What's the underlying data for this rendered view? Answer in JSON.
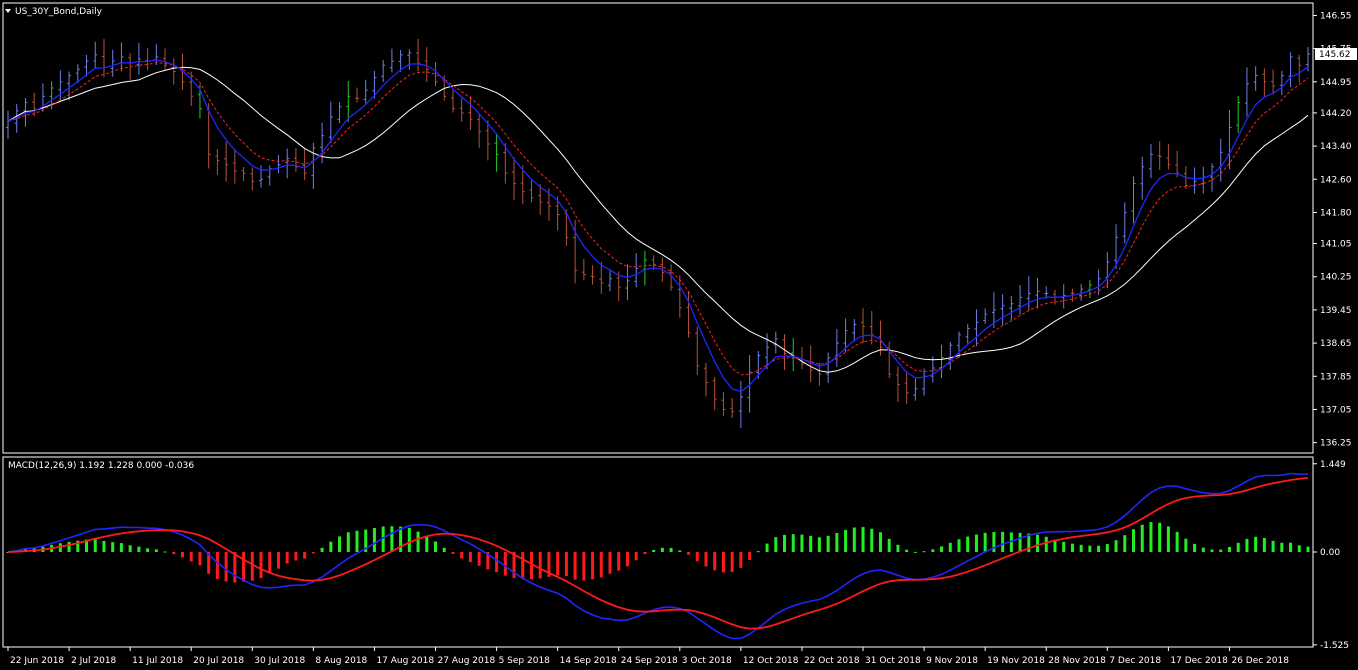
{
  "window": {
    "main_title": "US_30Y_Bond,Daily",
    "indicator_title": "MACD(12,26,9) 1.192 1.228 0.000 -0.036",
    "current_price_label": "145.62"
  },
  "colors": {
    "background": "#000000",
    "axis": "#ffffff",
    "bull_bar": "#6f7fe8",
    "bear_bar": "#b5533a",
    "green_bar": "#22cc22",
    "ma_fast": "#1f26ff",
    "ma_signal": "#ff2020",
    "ma_slow": "#ffffff",
    "hist_pos": "#22ee22",
    "hist_neg": "#ff1a1a",
    "macd_line": "#1f26ff",
    "signal_line": "#ff1a1a"
  },
  "chart_data": [
    {
      "type": "ohlc",
      "name": "US_30Y_Bond,Daily",
      "ylim": [
        136.0,
        146.85
      ],
      "y_ticks": [
        "146.55",
        "145.75",
        "144.95",
        "144.20",
        "143.40",
        "142.60",
        "141.80",
        "141.05",
        "140.25",
        "139.45",
        "138.65",
        "137.85",
        "137.05",
        "136.25"
      ],
      "x_tick_labels": [
        "22 Jun 2018",
        "2 Jul 2018",
        "11 Jul 2018",
        "20 Jul 2018",
        "30 Jul 2018",
        "8 Aug 2018",
        "17 Aug 2018",
        "27 Aug 2018",
        "5 Sep 2018",
        "14 Sep 2018",
        "24 Sep 2018",
        "3 Oct 2018",
        "12 Oct 2018",
        "22 Oct 2018",
        "31 Oct 2018",
        "9 Nov 2018",
        "19 Nov 2018",
        "28 Nov 2018",
        "7 Dec 2018",
        "17 Dec 2018",
        "26 Dec 2018"
      ],
      "x_tick_index": [
        0,
        7,
        14,
        21,
        28,
        35,
        42,
        49,
        56,
        63,
        70,
        77,
        84,
        91,
        98,
        105,
        112,
        119,
        126,
        133,
        140
      ],
      "current_price": 145.62,
      "close": [
        144.0,
        144.25,
        144.45,
        144.3,
        144.6,
        144.8,
        144.95,
        145.1,
        145.25,
        145.45,
        145.6,
        145.3,
        145.45,
        145.55,
        145.4,
        145.5,
        145.45,
        145.55,
        145.35,
        145.2,
        144.95,
        144.6,
        144.3,
        143.2,
        143.05,
        142.95,
        142.8,
        142.75,
        142.55,
        142.6,
        142.85,
        142.95,
        143.1,
        142.9,
        142.75,
        143.35,
        143.65,
        144.1,
        144.35,
        144.6,
        144.55,
        144.75,
        145.05,
        145.35,
        145.45,
        145.6,
        145.65,
        145.4,
        145.25,
        144.95,
        144.6,
        144.3,
        144.2,
        144.05,
        143.75,
        143.45,
        143.2,
        142.75,
        142.5,
        142.3,
        142.15,
        142.05,
        141.95,
        141.75,
        141.2,
        140.4,
        140.3,
        140.25,
        140.1,
        140.2,
        140.0,
        140.15,
        140.45,
        140.65,
        140.55,
        140.35,
        140.0,
        139.5,
        138.9,
        138.1,
        137.7,
        137.3,
        137.05,
        137.0,
        137.35,
        137.95,
        138.35,
        138.55,
        138.75,
        138.4,
        138.3,
        138.15,
        138.0,
        137.9,
        138.3,
        138.65,
        138.95,
        139.1,
        139.05,
        138.85,
        138.55,
        137.9,
        137.65,
        137.45,
        137.55,
        137.85,
        138.05,
        138.3,
        138.6,
        138.85,
        139.0,
        139.15,
        139.35,
        139.45,
        139.55,
        139.6,
        139.75,
        139.85,
        139.9,
        139.85,
        139.75,
        139.8,
        139.85,
        139.95,
        140.05,
        140.2,
        140.6,
        141.2,
        141.8,
        142.5,
        142.9,
        143.2,
        143.15,
        142.95,
        142.75,
        142.45,
        142.55,
        142.65,
        142.9,
        143.25,
        143.85,
        144.45,
        144.9,
        145.1,
        144.95,
        144.85,
        145.1,
        145.55,
        145.35,
        145.62
      ]
    },
    {
      "type": "macd",
      "name": "MACD(12,26,9)",
      "params": [
        12,
        26,
        9
      ],
      "values_shown": [
        1.192,
        1.228,
        0.0,
        -0.036
      ],
      "ylim": [
        -1.56,
        1.56
      ],
      "y_ticks": [
        "1.449",
        "0.00",
        "-1.525"
      ],
      "y_tick_values": [
        1.449,
        0.0,
        -1.525
      ]
    }
  ]
}
